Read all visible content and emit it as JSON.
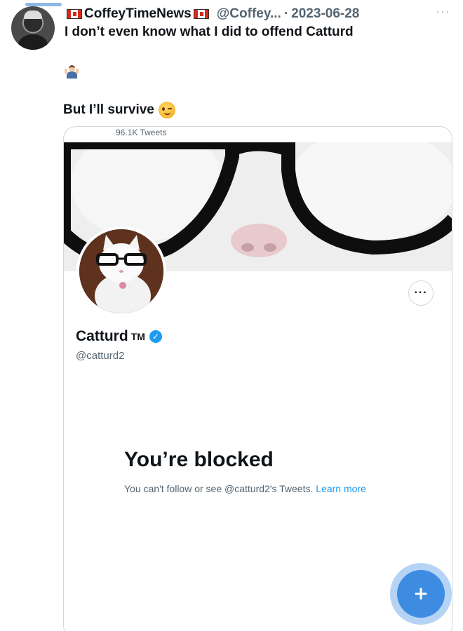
{
  "tweet": {
    "author_name": "CoffeyTimeNews",
    "author_handle": "@Coffey...",
    "separator": "·",
    "date": "2023-06-28",
    "more_label": "···",
    "text_line1": "I don’t even know what I did to offend Catturd",
    "text_line2": "But I’ll survive"
  },
  "embedded_profile": {
    "tweets_count": "96.1K Tweets",
    "display_name": "Catturd",
    "trademark": "TM",
    "username": "@catturd2",
    "more_button": "···",
    "blocked_title": "You’re blocked",
    "blocked_message": "You can't follow or see @catturd2's Tweets.",
    "learn_more": "Learn more"
  },
  "icons": {
    "verified": "✓",
    "compose": "+"
  },
  "colors": {
    "accent_blue": "#1d9bf0",
    "fab_blue": "#3d8ce2",
    "secondary_text": "#536471"
  }
}
